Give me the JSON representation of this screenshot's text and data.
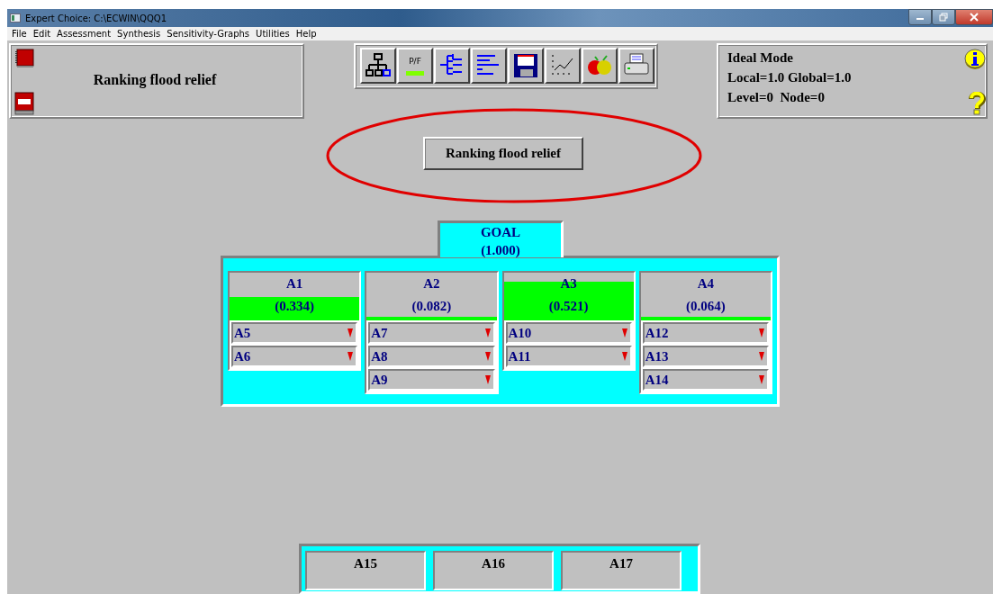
{
  "window": {
    "title": "Expert Choice: C:\\ECWIN\\QQQ1"
  },
  "menu": [
    "File",
    "Edit",
    "Assessment",
    "Synthesis",
    "Sensitivity-Graphs",
    "Utilities",
    "Help"
  ],
  "model_panel": {
    "title": "Ranking flood relief"
  },
  "toolbar": [
    {
      "kind": "hierarchy"
    },
    {
      "kind": "pf",
      "label": "P/F"
    },
    {
      "kind": "tree"
    },
    {
      "kind": "bars"
    },
    {
      "kind": "save"
    },
    {
      "kind": "graph"
    },
    {
      "kind": "fruit"
    },
    {
      "kind": "print"
    }
  ],
  "status_panel": {
    "lines": [
      "Ideal Mode",
      "Local=1.0 Global=1.0",
      "Level=0  Node=0"
    ]
  },
  "goal_button": "Ranking flood relief",
  "goal": {
    "label": "GOAL",
    "value": "(1.000)"
  },
  "nodes": [
    {
      "label": "A1",
      "value": "(0.334)",
      "children": [
        {
          "label": "A5"
        },
        {
          "label": "A6"
        }
      ]
    },
    {
      "label": "A2",
      "value": "(0.082)",
      "children": [
        {
          "label": "A7"
        },
        {
          "label": "A8"
        },
        {
          "label": "A9"
        }
      ]
    },
    {
      "label": "A3",
      "value": "(0.521)",
      "children": [
        {
          "label": "A10"
        },
        {
          "label": "A11"
        }
      ]
    },
    {
      "label": "A4",
      "value": "(0.064)",
      "children": [
        {
          "label": "A12"
        },
        {
          "label": "A13"
        },
        {
          "label": "A14"
        }
      ]
    }
  ],
  "lower_nodes": [
    {
      "label": "A15"
    },
    {
      "label": "A16"
    },
    {
      "label": "A17"
    }
  ]
}
